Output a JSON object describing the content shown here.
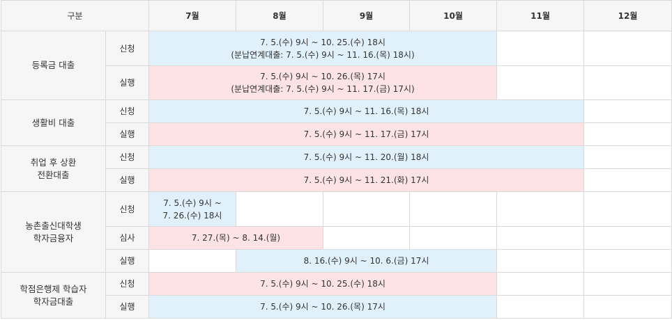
{
  "table": {
    "header": {
      "category": "구분",
      "months": [
        "7월",
        "8월",
        "9월",
        "10월",
        "11월",
        "12월"
      ]
    },
    "groups": [
      {
        "category": "등록금 대출",
        "rows": [
          {
            "stage": "신청",
            "period": "7. 5.(수) 9시 ~ 10. 25.(수) 18시\n(분납연계대출: 7. 5.(수) 9시 ~ 11. 16.(목) 18시)",
            "color": "#e1f1fb"
          },
          {
            "stage": "실행",
            "period": "7. 5.(수) 9시 ~ 10. 26.(목) 17시\n(분납연계대출: 7. 5.(수) 9시 ~ 11. 17.(금) 17시)",
            "color": "#fde3e6"
          }
        ]
      },
      {
        "category": "생활비 대출",
        "rows": [
          {
            "stage": "신청",
            "period": "7. 5.(수) 9시 ~ 11. 16.(목) 18시"
          },
          {
            "stage": "실행",
            "period": "7. 5.(수) 9시 ~ 11. 17.(금) 17시"
          }
        ]
      },
      {
        "category": "취업 후 상환\n전환대출",
        "rows": [
          {
            "stage": "신청",
            "period": "7. 5.(수) 9시 ~ 11. 20.(월) 18시"
          },
          {
            "stage": "실행",
            "period": "7. 5.(수) 9시 ~ 11. 21.(화) 17시"
          }
        ]
      },
      {
        "category": "농촌출신대학생\n학자금융자",
        "rows": [
          {
            "stage": "신청",
            "period": "7. 5.(수) 9시 ~\n7. 26.(수) 18시"
          },
          {
            "stage": "심사",
            "period": "7. 27.(목) ~ 8. 14.(월)"
          },
          {
            "stage": "실행",
            "period": "8. 16.(수) 9시 ~ 10. 6.(금) 17시"
          }
        ]
      },
      {
        "category": "학점은행제 학습자\n학자금대출",
        "rows": [
          {
            "stage": "신청",
            "period": "7. 5.(수) 9시 ~ 10. 25.(수) 18시"
          },
          {
            "stage": "실행",
            "period": "7. 5.(수) 9시 ~ 10. 26.(목) 17시"
          }
        ]
      }
    ]
  },
  "colors": {
    "apply": "#e1f1fb",
    "execute": "#fde3e6",
    "header_bg": "#f6f6f6",
    "border": "#d9d9d9"
  }
}
